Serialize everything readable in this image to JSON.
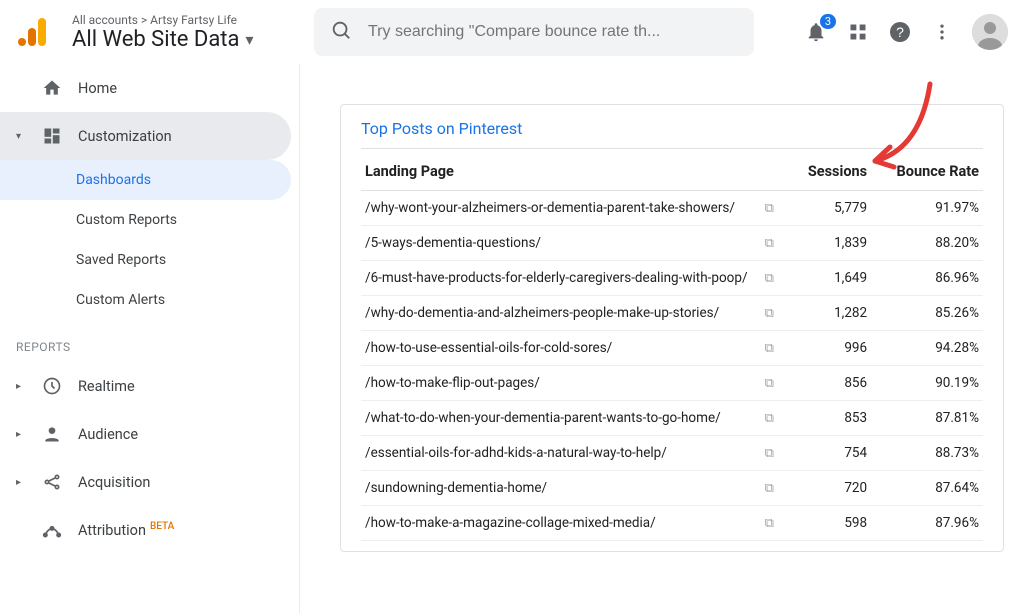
{
  "header": {
    "breadcrumb": "All accounts > Artsy Fartsy Life",
    "view_title": "All Web Site Data",
    "search_placeholder": "Try searching \"Compare bounce rate th...",
    "notification_count": "3"
  },
  "sidebar": {
    "home": "Home",
    "customization": "Customization",
    "sub": {
      "dashboards": "Dashboards",
      "custom_reports": "Custom Reports",
      "saved_reports": "Saved Reports",
      "custom_alerts": "Custom Alerts"
    },
    "reports_label": "REPORTS",
    "realtime": "Realtime",
    "audience": "Audience",
    "acquisition": "Acquisition",
    "attribution": "Attribution",
    "beta": "BETA"
  },
  "card": {
    "title": "Top Posts on Pinterest",
    "col_landing": "Landing Page",
    "col_sessions": "Sessions",
    "col_bounce": "Bounce Rate",
    "rows": [
      {
        "url": "/why-wont-your-alzheimers-or-dementia-parent-take-showers/",
        "sessions": "5,779",
        "bounce": "91.97%"
      },
      {
        "url": "/5-ways-dementia-questions/",
        "sessions": "1,839",
        "bounce": "88.20%"
      },
      {
        "url": "/6-must-have-products-for-elderly-caregivers-dealing-with-poop/",
        "sessions": "1,649",
        "bounce": "86.96%"
      },
      {
        "url": "/why-do-dementia-and-alzheimers-people-make-up-stories/",
        "sessions": "1,282",
        "bounce": "85.26%"
      },
      {
        "url": "/how-to-use-essential-oils-for-cold-sores/",
        "sessions": "996",
        "bounce": "94.28%"
      },
      {
        "url": "/how-to-make-flip-out-pages/",
        "sessions": "856",
        "bounce": "90.19%"
      },
      {
        "url": "/what-to-do-when-your-dementia-parent-wants-to-go-home/",
        "sessions": "853",
        "bounce": "87.81%"
      },
      {
        "url": "/essential-oils-for-adhd-kids-a-natural-way-to-help/",
        "sessions": "754",
        "bounce": "88.73%"
      },
      {
        "url": "/sundowning-dementia-home/",
        "sessions": "720",
        "bounce": "87.64%"
      },
      {
        "url": "/how-to-make-a-magazine-collage-mixed-media/",
        "sessions": "598",
        "bounce": "87.96%"
      }
    ]
  }
}
